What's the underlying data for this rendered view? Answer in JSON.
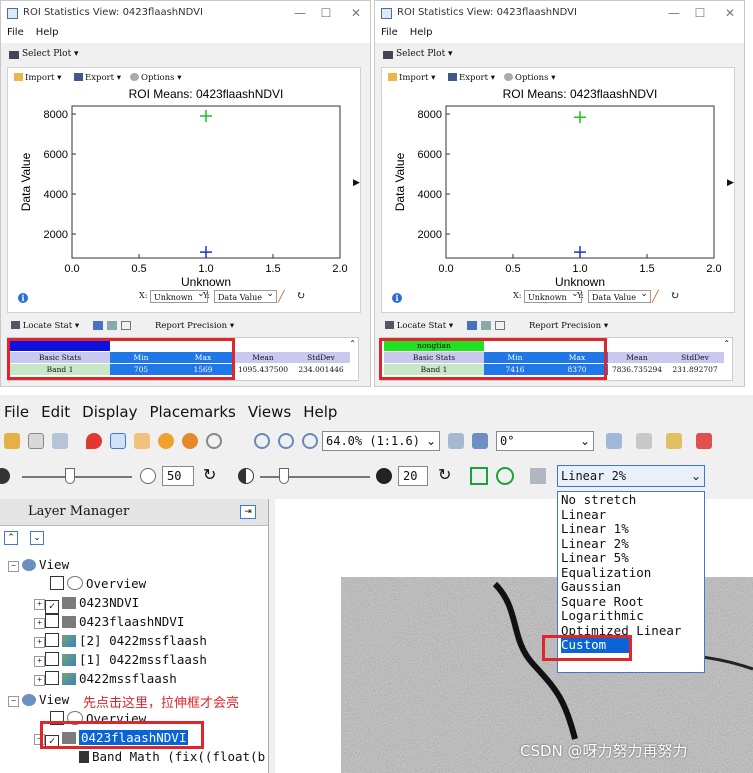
{
  "roi_windows": [
    {
      "title": "ROI Statistics View: 0423flaashNDVI",
      "menu": [
        "File",
        "Help"
      ],
      "select_plot": "Select Plot",
      "toolbar": {
        "import": "Import",
        "export": "Export",
        "options": "Options"
      },
      "controls": {
        "x_label": "X:",
        "x_value": "Unknown",
        "y_label": "Y:",
        "y_value": "Data Value"
      },
      "locate_stat": "Locate Stat",
      "report_precision": "Report Precision",
      "roi_name": "",
      "roi_color": "#1010e0",
      "stats": {
        "headers": [
          "Basic Stats",
          "Min",
          "Max",
          "Mean",
          "StdDev"
        ],
        "row": [
          "Band 1",
          "705",
          "1569",
          "1095.437500",
          "234.001446"
        ]
      },
      "chart_data": {
        "type": "scatter",
        "title": "ROI Means: 0423flaashNDVI",
        "xlabel": "Unknown",
        "ylabel": "Data Value",
        "xlim": [
          0.0,
          2.0
        ],
        "ylim": [
          800,
          8400
        ],
        "xticks": [
          "0.0",
          "0.5",
          "1.0",
          "1.5",
          "2.0"
        ],
        "yticks": [
          "2000",
          "4000",
          "6000",
          "8000"
        ],
        "series": [
          {
            "color": "#2030d0",
            "marker": "plus",
            "x": [
              1.0
            ],
            "y": [
              1095
            ]
          },
          {
            "color": "#20c020",
            "marker": "plus",
            "x": [
              1.0
            ],
            "y": [
              7900
            ]
          }
        ]
      }
    },
    {
      "title": "ROI Statistics View: 0423flaashNDVI",
      "menu": [
        "File",
        "Help"
      ],
      "select_plot": "Select Plot",
      "toolbar": {
        "import": "Import",
        "export": "Export",
        "options": "Options"
      },
      "controls": {
        "x_label": "X:",
        "x_value": "Unknown",
        "y_label": "Y:",
        "y_value": "Data Value"
      },
      "locate_stat": "Locate Stat",
      "report_precision": "Report Precision",
      "roi_name": "nongtian",
      "roi_color": "#22e022",
      "stats": {
        "headers": [
          "Basic Stats",
          "Min",
          "Max",
          "Mean",
          "StdDev"
        ],
        "row": [
          "Band 1",
          "7416",
          "8370",
          "7836.735294",
          "231.892707"
        ]
      },
      "chart_data": {
        "type": "scatter",
        "title": "ROI Means: 0423flaashNDVI",
        "xlabel": "Unknown",
        "ylabel": "Data Value",
        "xlim": [
          0.0,
          2.0
        ],
        "ylim": [
          800,
          8400
        ],
        "xticks": [
          "0.0",
          "0.5",
          "1.0",
          "1.5",
          "2.0"
        ],
        "yticks": [
          "2000",
          "4000",
          "6000",
          "8000"
        ],
        "series": [
          {
            "color": "#2030d0",
            "marker": "plus",
            "x": [
              1.0
            ],
            "y": [
              1095
            ]
          },
          {
            "color": "#20c020",
            "marker": "plus",
            "x": [
              1.0
            ],
            "y": [
              7837
            ]
          }
        ]
      }
    }
  ],
  "main": {
    "menu": [
      "File",
      "Edit",
      "Display",
      "Placemarks",
      "Views",
      "Help"
    ],
    "zoom_value": "64.0% (1:1.6)",
    "rotation_value": "0°",
    "brightness_value": "50",
    "contrast_value": "20",
    "stretch_selected": "Linear 2%",
    "stretch_options": [
      "No stretch",
      "Linear",
      "Linear 1%",
      "Linear 2%",
      "Linear 5%",
      "Equalization",
      "Gaussian",
      "Square Root",
      "Logarithmic",
      "Optimized Linear",
      "Custom"
    ],
    "stretch_highlighted": "Custom",
    "layer_manager_title": "Layer Manager",
    "tree": [
      {
        "label": "View",
        "level": 0,
        "checked": null
      },
      {
        "label": "Overview",
        "level": 1,
        "checked": false
      },
      {
        "label": "0423NDVI",
        "level": 1,
        "checked": true
      },
      {
        "label": "0423flaashNDVI",
        "level": 1,
        "checked": false
      },
      {
        "label": "[2] 0422mssflaash",
        "level": 1,
        "checked": false
      },
      {
        "label": "[1] 0422mssflaash",
        "level": 1,
        "checked": false
      },
      {
        "label": "0422mssflaash",
        "level": 1,
        "checked": false
      },
      {
        "label": "View",
        "level": 0,
        "checked": null
      },
      {
        "label": "Overview",
        "level": 1,
        "checked": false
      },
      {
        "label": "0423flaashNDVI",
        "level": 1,
        "checked": true
      },
      {
        "label": "Band Math (fix((float(b",
        "level": 2,
        "checked": null
      }
    ],
    "annotation": "先点击这里，拉伸框才会亮",
    "watermark": "CSDN @呀力努力再努力"
  }
}
